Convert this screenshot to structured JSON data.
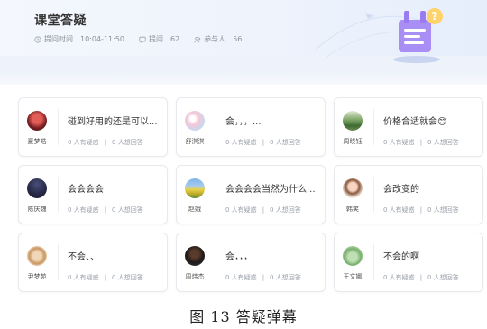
{
  "header": {
    "title": "课堂答疑",
    "time_label": "提问时间",
    "time_value": "10:04-11:50",
    "questions_label": "提问",
    "questions_count": "62",
    "participants_label": "参与人",
    "participants_count": "56"
  },
  "cards": [
    {
      "user": "夏梦皓",
      "text": "碰到好用的还是可以...",
      "ask": "0 人有疑惑",
      "answer": "0 人想回答",
      "avatar": "dark-red"
    },
    {
      "user": "舒淇淇",
      "text": "会，，，...",
      "ask": "0 人有疑惑",
      "answer": "0 人想回答",
      "avatar": "pink-blossom"
    },
    {
      "user": "周晓钰",
      "text": "价格合适就会😊",
      "ask": "0 人有疑惑",
      "answer": "0 人想回答",
      "avatar": "green-scene"
    },
    {
      "user": "陈庆魏",
      "text": "会会会会",
      "ask": "0 人有疑惑",
      "answer": "0 人想回答",
      "avatar": "night"
    },
    {
      "user": "赵娥",
      "text": "会会会会当然为什么...",
      "ask": "0 人有疑惑",
      "answer": "0 人想回答",
      "avatar": "rape-field"
    },
    {
      "user": "韩笑",
      "text": "会改变的",
      "ask": "0 人有疑惑",
      "answer": "0 人想回答",
      "avatar": "girl"
    },
    {
      "user": "尹梦苑",
      "text": "不会、、",
      "ask": "0 人有疑惑",
      "answer": "0 人想回答",
      "avatar": "cat"
    },
    {
      "user": "周炜杰",
      "text": "会，，，",
      "ask": "0 人有疑惑",
      "answer": "0 人想回答",
      "avatar": "man"
    },
    {
      "user": "王文娜",
      "text": "不会的啊",
      "ask": "0 人有疑惑",
      "answer": "0 人想回答",
      "avatar": "plant"
    }
  ],
  "caption": "图 13  答疑弹幕"
}
